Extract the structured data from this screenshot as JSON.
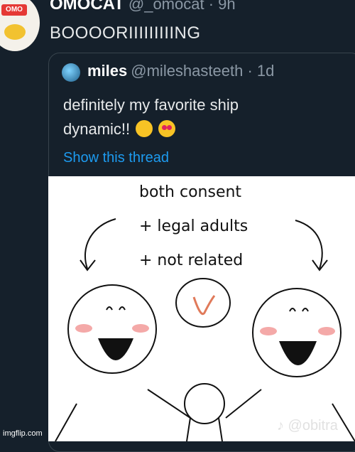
{
  "main_tweet": {
    "name": "OMOCAT",
    "handle": "@_omocat · 9h",
    "text": "BOOOORIIIIIIIIING",
    "avatar_text": "OMO"
  },
  "quoted_tweet": {
    "name": "miles",
    "handle": "@mileshasteeth · 1d",
    "text_line1": "definitely my favorite ship",
    "text_line2": "dynamic!!",
    "link": "Show this thread"
  },
  "comic": {
    "caption_1": "both consent",
    "caption_2": "+ legal adults",
    "caption_3": "+ not related"
  },
  "watermark": {
    "tiktok": "♪ @obitra",
    "imgflip": "imgflip.com"
  },
  "colors": {
    "background": "#15202b",
    "link": "#1d9bf0",
    "muted": "#8b98a5"
  }
}
